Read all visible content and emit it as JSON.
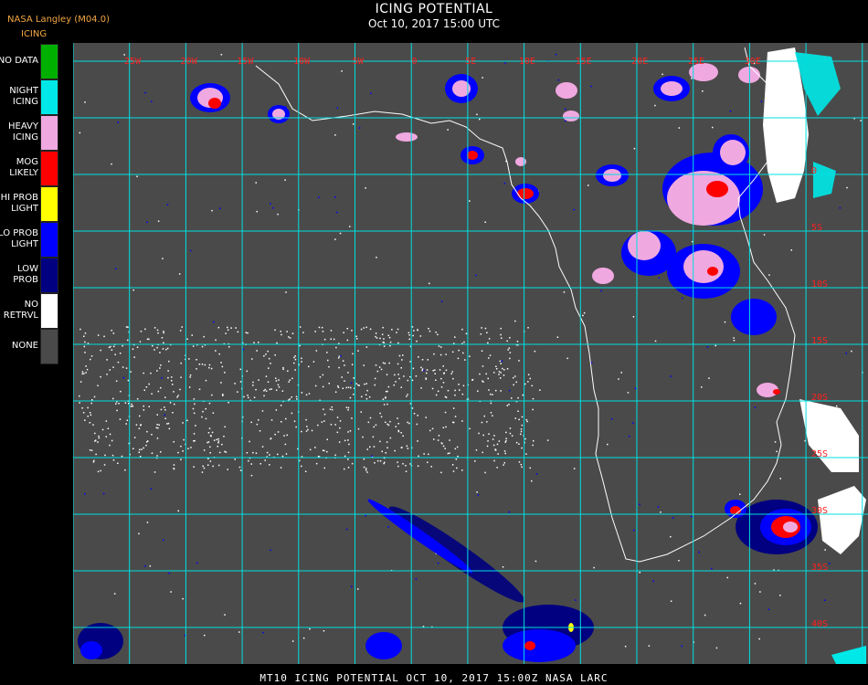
{
  "producer": "NASA Langley (M04.0)",
  "product_short": "ICING",
  "title": "ICING POTENTIAL",
  "subtitle": "Oct 10, 2017 15:00 UTC",
  "footer": "MT10  ICING POTENTIAL   OCT 10, 2017 15:00Z   NASA LARC",
  "legend": [
    {
      "label": "NO DATA",
      "color": "#00b000"
    },
    {
      "label": "NIGHT\nICING",
      "color": "#00e8e8"
    },
    {
      "label": "HEAVY\nICING",
      "color": "#f0a8e0"
    },
    {
      "label": "MOG\nLIKELY",
      "color": "#ff0000"
    },
    {
      "label": "HI PROB\nLIGHT",
      "color": "#ffff00"
    },
    {
      "label": "LO PROB\nLIGHT",
      "color": "#0000ff"
    },
    {
      "label": "LOW\nPROB",
      "color": "#000080"
    },
    {
      "label": "NO\nRETRVL",
      "color": "#ffffff"
    },
    {
      "label": "NONE",
      "color": "#4a4a4a"
    }
  ],
  "colors": {
    "grid": "#00e0e0",
    "coast": "#ffffff",
    "graticule_labels": "#ff2020",
    "background": "#4a4a4a"
  },
  "graticule": {
    "lon_labels": [
      "25W",
      "20W",
      "15W",
      "10W",
      "5W",
      "0",
      "5E",
      "10E",
      "15E",
      "20E",
      "25E",
      "30E"
    ],
    "lat_labels": [
      "0",
      "5S",
      "10S",
      "15S",
      "20S",
      "25S",
      "30S",
      "35S",
      "40S"
    ]
  }
}
